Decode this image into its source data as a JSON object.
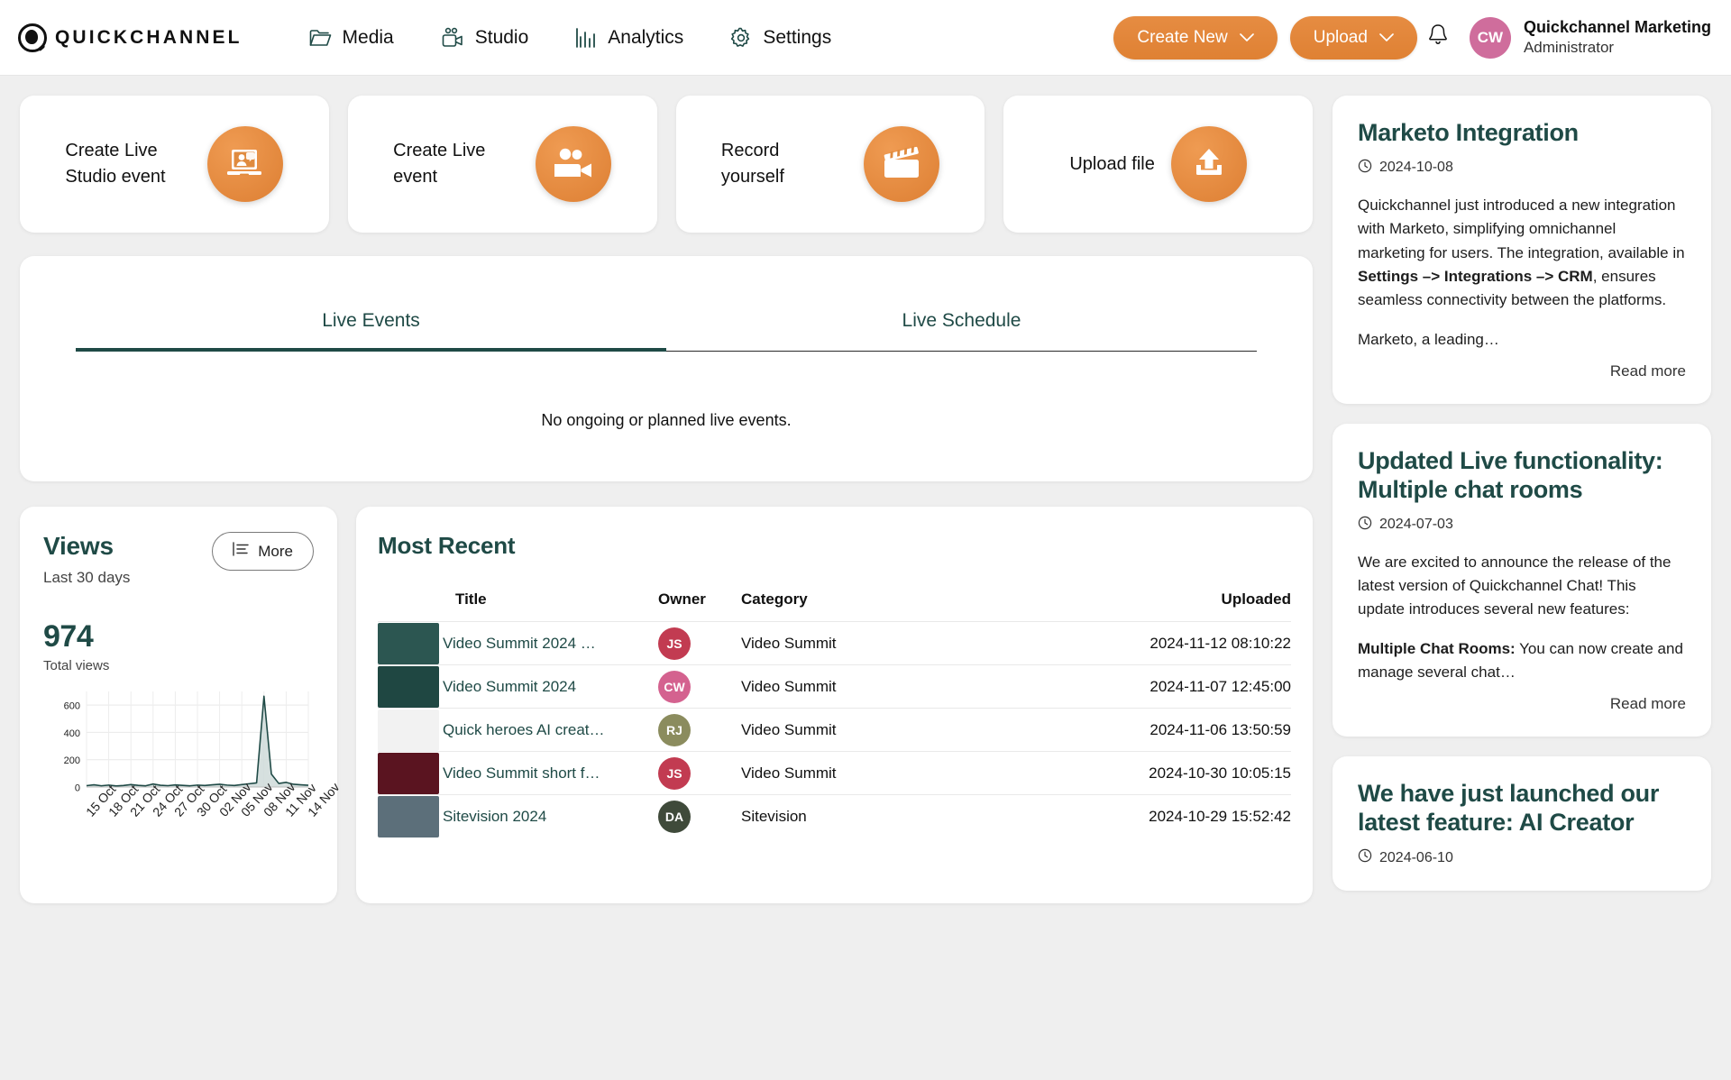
{
  "header": {
    "brand": "QUICKCHANNEL",
    "nav": [
      {
        "label": "Media",
        "icon": "folder-icon"
      },
      {
        "label": "Studio",
        "icon": "video-camera-icon"
      },
      {
        "label": "Analytics",
        "icon": "bar-chart-icon"
      },
      {
        "label": "Settings",
        "icon": "gear-icon"
      }
    ],
    "create_new_label": "Create New",
    "upload_label": "Upload",
    "avatar_initials": "CW",
    "user_name": "Quickchannel Marketing",
    "user_role": "Administrator"
  },
  "quick_actions": [
    {
      "label": "Create Live Studio event",
      "icon": "presenter-laptop-icon"
    },
    {
      "label": "Create Live event",
      "icon": "studio-camera-icon"
    },
    {
      "label": "Record yourself",
      "icon": "clapperboard-icon"
    },
    {
      "label": "Upload file",
      "icon": "upload-tray-icon"
    }
  ],
  "live": {
    "tabs": [
      {
        "label": "Live Events",
        "active": true
      },
      {
        "label": "Live Schedule",
        "active": false
      }
    ],
    "empty_message": "No ongoing or planned live events."
  },
  "views": {
    "title": "Views",
    "subtitle": "Last 30 days",
    "more_label": "More",
    "total": "974",
    "total_label": "Total views"
  },
  "chart_data": {
    "type": "area",
    "title": "Views",
    "subtitle": "Last 30 days",
    "xlabel": "",
    "ylabel": "",
    "ylim": [
      0,
      700
    ],
    "yticks": [
      0,
      200,
      400,
      600
    ],
    "grid": true,
    "legend": "none",
    "categories": [
      "15 Oct",
      "16 Oct",
      "17 Oct",
      "18 Oct",
      "19 Oct",
      "20 Oct",
      "21 Oct",
      "22 Oct",
      "23 Oct",
      "24 Oct",
      "25 Oct",
      "26 Oct",
      "27 Oct",
      "28 Oct",
      "29 Oct",
      "30 Oct",
      "31 Oct",
      "01 Nov",
      "02 Nov",
      "03 Nov",
      "04 Nov",
      "05 Nov",
      "06 Nov",
      "07 Nov",
      "08 Nov",
      "09 Nov",
      "10 Nov",
      "11 Nov",
      "12 Nov",
      "13 Nov",
      "14 Nov"
    ],
    "tick_labels": [
      "15 Oct",
      "18 Oct",
      "21 Oct",
      "24 Oct",
      "27 Oct",
      "30 Oct",
      "02 Nov",
      "05 Nov",
      "08 Nov",
      "11 Nov",
      "14 Nov"
    ],
    "values": [
      10,
      16,
      9,
      14,
      8,
      11,
      18,
      12,
      9,
      22,
      13,
      10,
      15,
      12,
      9,
      14,
      11,
      16,
      20,
      14,
      11,
      18,
      24,
      30,
      665,
      95,
      26,
      34,
      20,
      16,
      13
    ],
    "series": [
      {
        "name": "Views",
        "values": [
          10,
          16,
          9,
          14,
          8,
          11,
          18,
          12,
          9,
          22,
          13,
          10,
          15,
          12,
          9,
          14,
          11,
          16,
          20,
          14,
          11,
          18,
          24,
          30,
          665,
          95,
          26,
          34,
          20,
          16,
          13
        ]
      }
    ],
    "line_color": "#1f4a46",
    "fill_color": "#cfdbd9"
  },
  "recent": {
    "title": "Most Recent",
    "columns": [
      "Title",
      "Owner",
      "Category",
      "Uploaded"
    ],
    "rows": [
      {
        "title": "Video Summit 2024 …",
        "owner": "JS",
        "owner_color": "#c23b51",
        "category": "Video Summit",
        "uploaded": "2024-11-12 08:10:22",
        "thumb": "#2c5651"
      },
      {
        "title": "Video Summit 2024",
        "owner": "CW",
        "owner_color": "#d4628f",
        "category": "Video Summit",
        "uploaded": "2024-11-07 12:45:00",
        "thumb": "#1f4742"
      },
      {
        "title": "Quick heroes AI creat…",
        "owner": "RJ",
        "owner_color": "#8b8c5e",
        "category": "Video Summit",
        "uploaded": "2024-11-06 13:50:59",
        "thumb": "#f2f2f2"
      },
      {
        "title": "Video Summit short f…",
        "owner": "JS",
        "owner_color": "#c23b51",
        "category": "Video Summit",
        "uploaded": "2024-10-30 10:05:15",
        "thumb": "#5a1420"
      },
      {
        "title": "Sitevision 2024",
        "owner": "DA",
        "owner_color": "#3f4a3a",
        "category": "Sitevision",
        "uploaded": "2024-10-29 15:52:42",
        "thumb": "#5c6f7a"
      }
    ]
  },
  "news": [
    {
      "title": "Marketo Integration",
      "date": "2024-10-08",
      "p1_a": "Quickchannel just introduced a new integration with Marketo, simplifying omnichannel marketing for users. The integration, available in ",
      "p1_b": "Settings –> Integrations –> CRM",
      "p1_c": ", ensures seamless connectivity between the platforms.",
      "p2": "Marketo, a leading…",
      "read_more": "Read more"
    },
    {
      "title": "Updated Live functionality: Multiple chat rooms",
      "date": "2024-07-03",
      "p1_a": "We are excited to announce the release of the latest version of Quickchannel Chat! This update introduces several new features:",
      "p2_b": "Multiple Chat Rooms:",
      "p2_c": " You can now create and manage several chat…",
      "read_more": "Read more"
    },
    {
      "title": "We have just launched our latest feature: AI Creator",
      "date": "2024-06-10"
    }
  ]
}
